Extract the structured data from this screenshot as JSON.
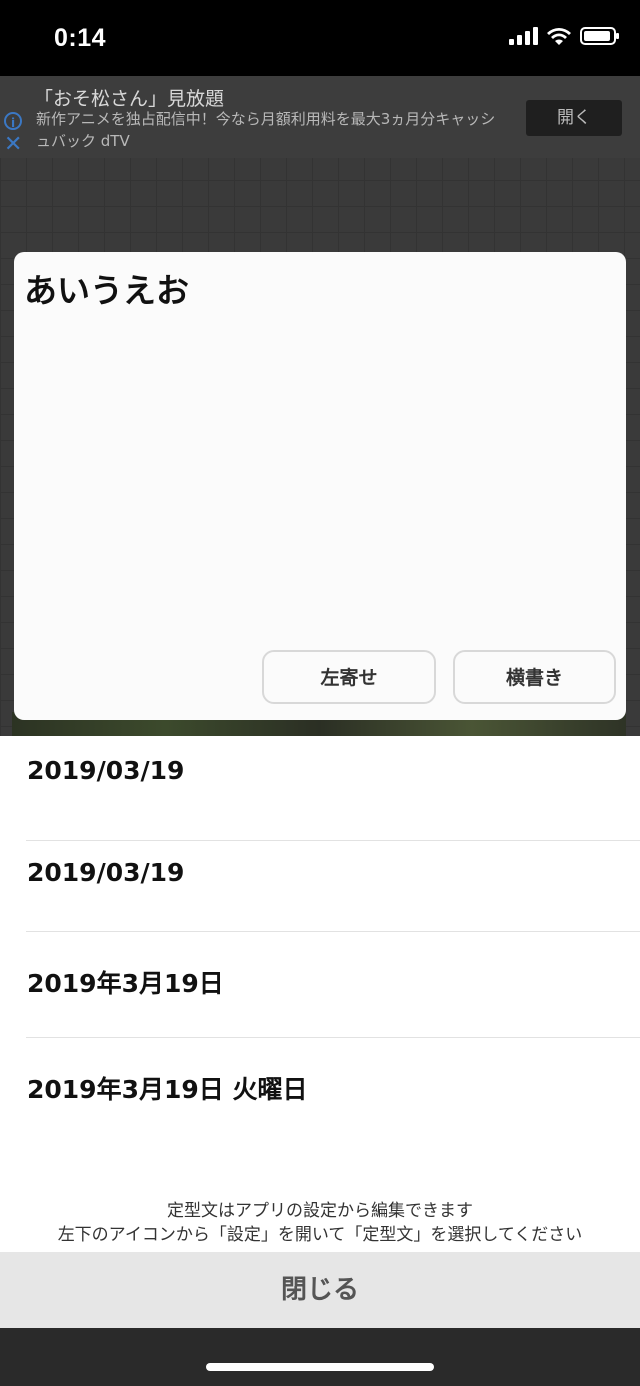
{
  "status_bar": {
    "time": "0:14"
  },
  "ad": {
    "title": "「おそ松さん」見放題",
    "description": "新作アニメを独占配信中！今なら月額利用料を最大3ヵ月分キャッシュバック dTV",
    "open_label": "開く",
    "info_icon": "info-icon",
    "close_icon": "close-icon"
  },
  "preview": {
    "text": "あいうえお",
    "align_button": "左寄せ",
    "direction_button": "横書き"
  },
  "templates": [
    "2019/03/19",
    "2019/03/19",
    "2019年3月19日",
    "2019年3月19日 火曜日"
  ],
  "hint": {
    "line1": "定型文はアプリの設定から編集できます",
    "line2": "左下のアイコンから「設定」を開いて「定型文」を選択してください"
  },
  "close_label": "閉じる",
  "colors": {
    "ad_icon": "#3b78c4",
    "close_bar": "#e6e6e6"
  }
}
